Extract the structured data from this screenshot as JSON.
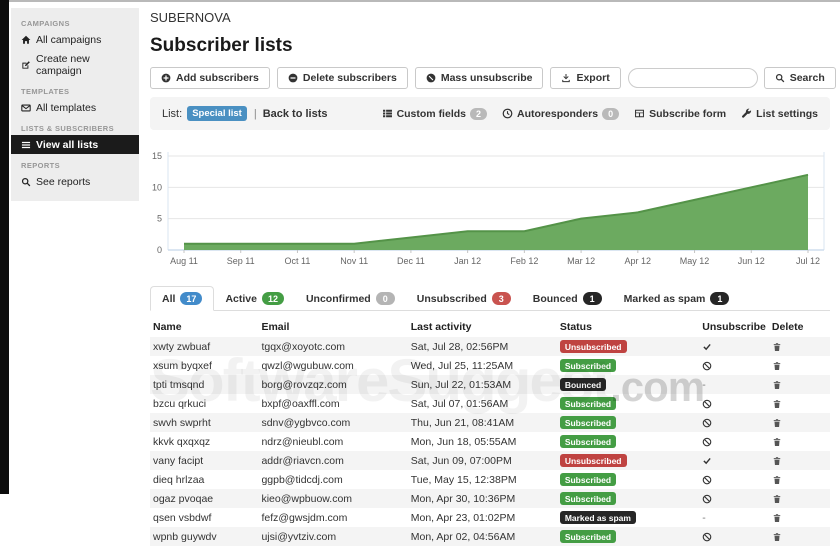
{
  "app": {
    "title": "SUBERNOVA",
    "page_title": "Subscriber lists"
  },
  "sidebar": {
    "sections": [
      {
        "label": "CAMPAIGNS",
        "items": [
          {
            "icon": "home-icon",
            "glyph": "home",
            "label": "All campaigns",
            "active": false
          },
          {
            "icon": "edit-icon",
            "glyph": "edit",
            "label": "Create new campaign",
            "active": false
          }
        ]
      },
      {
        "label": "TEMPLATES",
        "items": [
          {
            "icon": "envelope-icon",
            "glyph": "envelope",
            "label": "All templates",
            "active": false
          }
        ]
      },
      {
        "label": "LISTS & SUBSCRIBERS",
        "items": [
          {
            "icon": "list-icon",
            "glyph": "list",
            "label": "View all lists",
            "active": true
          }
        ]
      },
      {
        "label": "REPORTS",
        "items": [
          {
            "icon": "search-icon",
            "glyph": "magnifier",
            "label": "See reports",
            "active": false
          }
        ]
      }
    ]
  },
  "toolbar": {
    "buttons": [
      {
        "icon": "plus-circle-icon",
        "glyph": "plus-circle",
        "label": "Add subscribers"
      },
      {
        "icon": "minus-circle-icon",
        "glyph": "minus-circle",
        "label": "Delete subscribers"
      },
      {
        "icon": "ban-circle-icon",
        "glyph": "ban-circle",
        "label": "Mass unsubscribe"
      },
      {
        "icon": "download-icon",
        "glyph": "download",
        "label": "Export"
      }
    ],
    "search": {
      "value": "",
      "placeholder": "",
      "button_label": "Search"
    }
  },
  "listbar": {
    "prefix": "List:",
    "list_badge": "Special list",
    "separator": "|",
    "back_link": "Back to lists",
    "actions": [
      {
        "icon": "th-list-icon",
        "glyph": "th-list",
        "label": "Custom fields",
        "badge": "2"
      },
      {
        "icon": "clock-icon",
        "glyph": "clock",
        "label": "Autoresponders",
        "badge": "0"
      },
      {
        "icon": "table-icon",
        "glyph": "table-grid",
        "label": "Subscribe form",
        "badge": null
      },
      {
        "icon": "wrench-icon",
        "glyph": "wrench",
        "label": "List settings",
        "badge": null
      }
    ]
  },
  "chart_data": {
    "type": "area",
    "title": "",
    "xlabel": "",
    "ylabel": "",
    "x": [
      "Aug 11",
      "Sep 11",
      "Oct 11",
      "Nov 11",
      "Dec 11",
      "Jan 12",
      "Feb 12",
      "Mar 12",
      "Apr 12",
      "May 12",
      "Jun 12",
      "Jul 12"
    ],
    "values": [
      1,
      1,
      1,
      1,
      2,
      3,
      3,
      5,
      6,
      8,
      10,
      12
    ],
    "ylim": [
      0,
      15
    ],
    "yticks": [
      0,
      5,
      10,
      15
    ],
    "grid": true,
    "legend": false,
    "fill_color": "#6caa60",
    "line_color": "#549348"
  },
  "tabs": [
    {
      "label": "All",
      "count": "17",
      "badge_color": "#428bca",
      "active": true
    },
    {
      "label": "Active",
      "count": "12",
      "badge_color": "#449d44",
      "active": false
    },
    {
      "label": "Unconfirmed",
      "count": "0",
      "badge_color": "#b4b4b4",
      "active": false
    },
    {
      "label": "Unsubscribed",
      "count": "3",
      "badge_color": "#c9534f",
      "active": false
    },
    {
      "label": "Bounced",
      "count": "1",
      "badge_color": "#262626",
      "active": false
    },
    {
      "label": "Marked as spam",
      "count": "1",
      "badge_color": "#262626",
      "active": false
    }
  ],
  "table": {
    "columns": [
      "Name",
      "Email",
      "Last activity",
      "Status",
      "Unsubscribe",
      "Delete"
    ],
    "rows": [
      {
        "name": "xwty zwbuaf",
        "email": "tgqx@xoyotc.com",
        "activity": "Sat, Jul 28, 02:56PM",
        "status": "Unsubscribed",
        "status_type": "unsubscribed",
        "unsubscribe": "check"
      },
      {
        "name": "xsum byqxef",
        "email": "qwzl@wgubuw.com",
        "activity": "Wed, Jul 25, 11:25AM",
        "status": "Subscribed",
        "status_type": "subscribed",
        "unsubscribe": "ban"
      },
      {
        "name": "tpti tmsqnd",
        "email": "borg@rovzqz.com",
        "activity": "Sun, Jul 22, 01:53AM",
        "status": "Bounced",
        "status_type": "bounced",
        "unsubscribe": "dash"
      },
      {
        "name": "bzcu qrkuci",
        "email": "bxpf@oaxffl.com",
        "activity": "Sat, Jul 07, 01:56AM",
        "status": "Subscribed",
        "status_type": "subscribed",
        "unsubscribe": "ban"
      },
      {
        "name": "swvh swprht",
        "email": "sdnv@ygbvco.com",
        "activity": "Thu, Jun 21, 08:41AM",
        "status": "Subscribed",
        "status_type": "subscribed",
        "unsubscribe": "ban"
      },
      {
        "name": "kkvk qxqxqz",
        "email": "ndrz@nieubl.com",
        "activity": "Mon, Jun 18, 05:55AM",
        "status": "Subscribed",
        "status_type": "subscribed",
        "unsubscribe": "ban"
      },
      {
        "name": "vany facipt",
        "email": "addr@riavcn.com",
        "activity": "Sat, Jun 09, 07:00PM",
        "status": "Unsubscribed",
        "status_type": "unsubscribed",
        "unsubscribe": "check"
      },
      {
        "name": "dieq hrlzaa",
        "email": "ggpb@tidcdj.com",
        "activity": "Tue, May 15, 12:38PM",
        "status": "Subscribed",
        "status_type": "subscribed",
        "unsubscribe": "ban"
      },
      {
        "name": "ogaz pvoqae",
        "email": "kieo@wpbuow.com",
        "activity": "Mon, Apr 30, 10:36PM",
        "status": "Subscribed",
        "status_type": "subscribed",
        "unsubscribe": "ban"
      },
      {
        "name": "qsen vsbdwf",
        "email": "fefz@gwsjdm.com",
        "activity": "Mon, Apr 23, 01:02PM",
        "status": "Marked as spam",
        "status_type": "spam",
        "unsubscribe": "dash"
      },
      {
        "name": "wpnb guywdv",
        "email": "ujsi@yvtziv.com",
        "activity": "Mon, Apr 02, 04:56AM",
        "status": "Subscribed",
        "status_type": "subscribed",
        "unsubscribe": "ban"
      }
    ]
  },
  "watermark": {
    "text": "SoftwareSuggest",
    "suffix": ".com"
  },
  "colors": {
    "list_badge_blue": "#4a90c2",
    "sidebar_active_bg": "#1b1b1b",
    "chart_fill": "#6caa60",
    "chart_line": "#549348",
    "status": {
      "subscribed": "#449d44",
      "unsubscribed": "#bf4341",
      "bounced": "#262626",
      "spam": "#262626"
    }
  }
}
